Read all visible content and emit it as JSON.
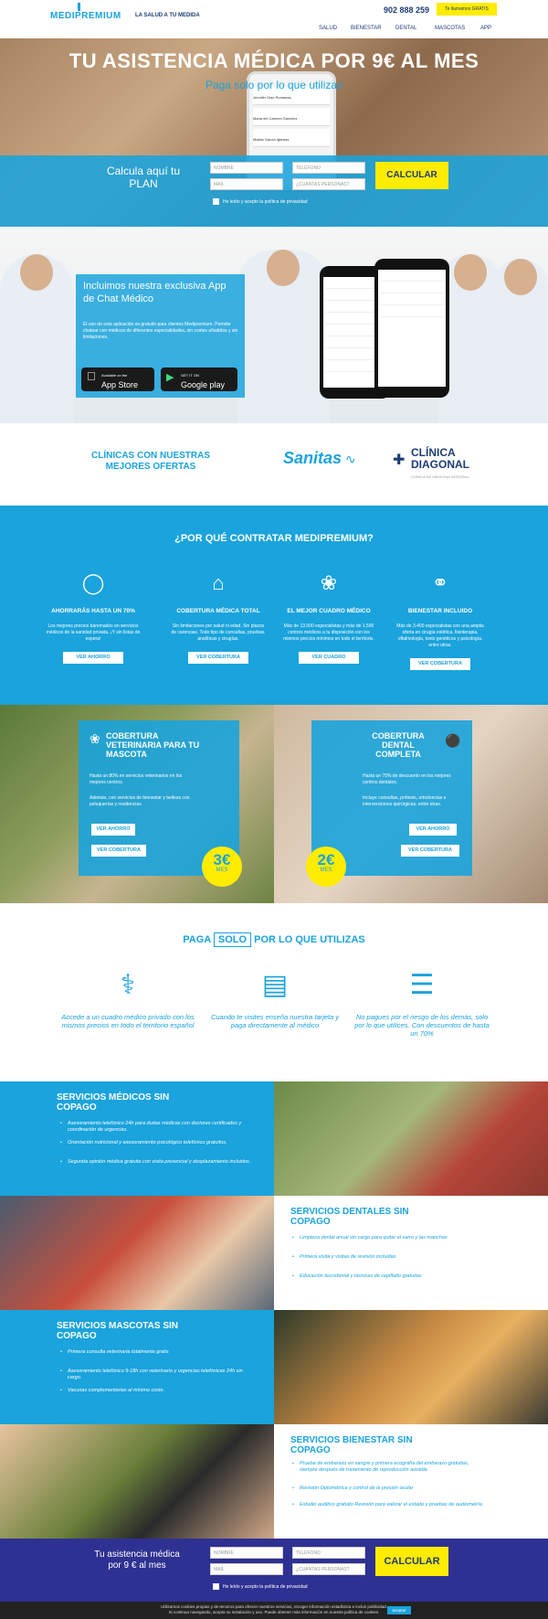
{
  "header": {
    "logo": "MEDIPREMIUM",
    "tagline": "LA SALUD A TU MEDIDA",
    "phone": "902 888 259",
    "call_button": "Te llamamos GRATIS",
    "nav": [
      "SALUD",
      "BIENESTAR",
      "DENTAL",
      "MASCOTAS",
      "APP"
    ]
  },
  "hero": {
    "title": "TU ASISTENCIA MÉDICA POR 9€ AL MES",
    "subtitle": "Paga solo por lo que utilizas",
    "phone_contacts": [
      "Jennifer Diaz Romanas",
      "Maria del Carmen Sanchez",
      "Matias Garcia Iglesias"
    ]
  },
  "calculator": {
    "title": "Calcula aquí tu PLAN",
    "name_placeholder": "NOMBRE",
    "phone_placeholder": "TELÉFONO",
    "email_placeholder": "MAIL",
    "persons_placeholder": "¿CUÁNTAS PERSONAS?",
    "button": "CALCULAR",
    "privacy": "He leído y acepto la política de privacidad"
  },
  "app": {
    "title": "Incluimos nuestra exclusiva App de Chat Médico",
    "description": "El uso de esta aplicación es gratuito para clientes Medipremium. Permite chatear con médicos de diferentes especialidades, sin costes añadidos y sin limitaciones.",
    "appstore_small": "Available on the",
    "appstore": "App Store",
    "googleplay_small": "GET IT ON",
    "googleplay": "Google play"
  },
  "clinics": {
    "title": "CLÍNICAS CON NUESTRAS MEJORES OFERTAS",
    "sanitas": "Sanitas",
    "diagonal_1": "CLÍNICA",
    "diagonal_2": "DIAGONAL",
    "diagonal_sub": "CLÍNICA DE MEDICINA INTEGRAL"
  },
  "why": {
    "title": "¿POR QUÉ CONTRATAR MEDIPREMIUM?",
    "features": [
      {
        "icon": "piggy-bank-icon",
        "title": "AHORRARÁS HASTA UN 70%",
        "desc": "Los mejores precios baremados en servicios médicos de la sanidad privada. ¡Y sin listas de espera!",
        "button": "VER AHORRO"
      },
      {
        "icon": "medical-house-icon",
        "title": "COBERTURA MÉDICA TOTAL",
        "desc": "Sin limitaciones por salud ni edad. Sin plazos de carencias. Todo tipo de consultas, pruebas, analíticas y cirugías.",
        "button": "VER COBERTURA"
      },
      {
        "icon": "network-icon",
        "title": "EL MEJOR CUADRO MÉDICO",
        "desc": "Más de 13.000 especialistas y más de 1.500 centros médicos a tu disposición con los mismos precios mínimos en todo el territorio.",
        "button": "VER CUADRO"
      },
      {
        "icon": "stethoscope-icon",
        "title": "BIENESTAR INCLUIDO",
        "desc": "Más de 3.400 especialistas con una amplia oferta en cirugía estética, fisioterapia, oftalmología, tests genéticos y psicología, entre otras.",
        "button": "VER COBERTURA"
      }
    ]
  },
  "pets": {
    "title": "COBERTURA VETERINARIA PARA TU MASCOTA",
    "p1": "Hasta un 80% en servicios veterinarios en los mejores centros.",
    "p2": "Además, con servicios de bienestar y belleza con peluquerías y residencias.",
    "btn1": "VER AHORRO",
    "btn2": "VER COBERTURA",
    "price": "3€",
    "per": "MES"
  },
  "dental": {
    "title": "COBERTURA DENTAL COMPLETA",
    "p1": "Hasta un 70% de descuento en los mejores centros dentales.",
    "p2": "Incluye consultas, prótesis, ortodoncias e intervenciones quirúrgicas, entre otras.",
    "btn1": "VER AHORRO",
    "btn2": "VER COBERTURA",
    "price": "2€",
    "per": "MES"
  },
  "pay": {
    "title_pre": "PAGA",
    "title_boxed": "SOLO",
    "title_post": "POR LO QUE UTILIZAS",
    "items": [
      {
        "icon": "doctor-icon",
        "text": "Accede a un cuadro médico privado con los mismos precios en todo el territorio español"
      },
      {
        "icon": "card-icon",
        "text": "Cuando te visites enseña nuestra tarjeta y paga directamente al médico"
      },
      {
        "icon": "document-icon",
        "text": "No pagues por el riesgo de los demás, solo por lo que utilices. Con descuentos de hasta un 70%"
      }
    ]
  },
  "services": {
    "medical": {
      "title": "SERVICIOS MÉDICOS SIN COPAGO",
      "items": [
        "Asesoramiento telefónico 24h para dudas médicas con doctores certificados y coordinación de urgencias.",
        "Orientación nutricional y asesoramiento psicológico telefónico gratuitos.",
        "Segunda opinión médica gratuita con visita presencial y desplazamiento incluidos."
      ]
    },
    "dental": {
      "title": "SERVICIOS DENTALES SIN COPAGO",
      "items": [
        "Limpieza dental anual sin cargo para quitar el sarro y las manchas",
        "Primera visita y visitas de revisión incluidas",
        "Educación bucodental y técnicas de cepillado gratuitas"
      ]
    },
    "pets": {
      "title": "SERVICIOS MASCOTAS SIN COPAGO",
      "items": [
        "Primera consulta veterinaria totalmente gratis",
        "Asesoramiento telefónico 9-18h con veterinario y urgencias telefónicas 24h sin cargo.",
        "Vacunas complementarias al mínimo coste."
      ]
    },
    "wellness": {
      "title": "SERVICIOS BIENESTAR SIN COPAGO",
      "items": [
        "Prueba de embarazo en sangre y primera ecografía del embarazo gratuitas, siempre después de tratamiento de reproducción asistida",
        "Revisión Optométrica y control de la presión ocular",
        "Estudio auditivo gratuito Revisión para valorar el estado y pruebas de audiometría"
      ]
    }
  },
  "bottom_calc": {
    "title": "Tu asistencia médica por 9 € al mes"
  },
  "cookie": {
    "text1": "Utilizamos cookies propias y de terceros para ofrecer nuestros servicios, recoger información estadística e incluir publicidad.",
    "text2": "Si continua navegando, acepta su instalación y uso. Puede obtener más información en nuestra política de cookies.",
    "accept": "aceptar"
  }
}
